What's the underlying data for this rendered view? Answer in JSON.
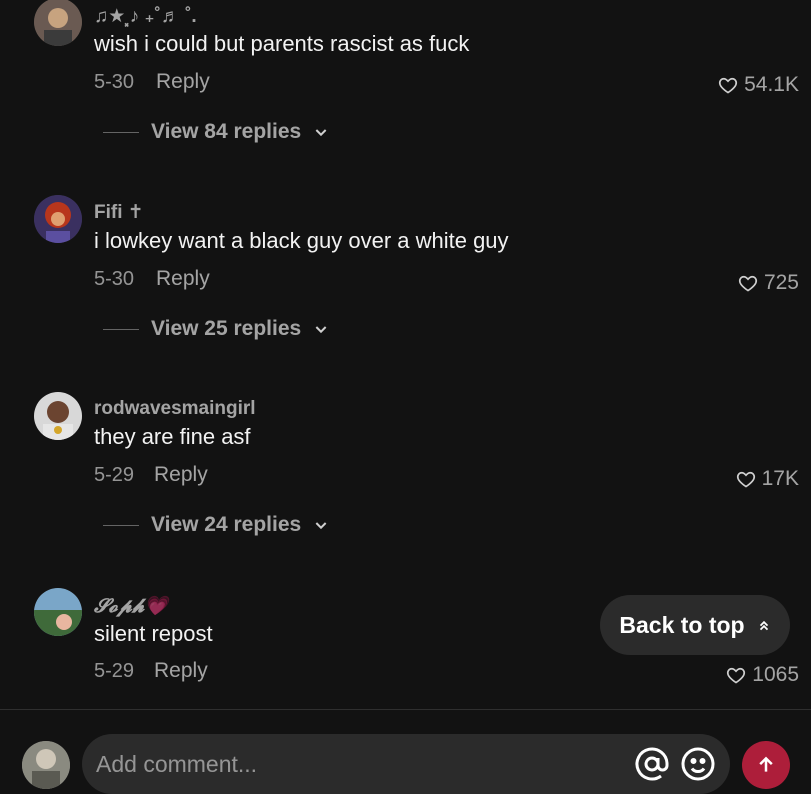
{
  "comments": [
    {
      "username": "♫★⸼♪ ₊˚♬ ˚.",
      "text": "wish i could but parents rascist as fuck",
      "date": "5-30",
      "reply_label": "Reply",
      "likes": "54.1K",
      "view_replies": "View 84 replies"
    },
    {
      "username": "Fifi ✝",
      "text": "i lowkey want a black guy over a white guy",
      "date": "5-30",
      "reply_label": "Reply",
      "likes": "725",
      "view_replies": "View 25 replies"
    },
    {
      "username": "rodwavesmaingirl",
      "text": "they are fine asf",
      "date": "5-29",
      "reply_label": "Reply",
      "likes": "17K",
      "view_replies": "View 24 replies"
    },
    {
      "username": "𝓢𝓸𝓹𝓱💗",
      "text": "silent repost",
      "date": "5-29",
      "reply_label": "Reply",
      "likes": "1065"
    }
  ],
  "back_to_top": "Back to top",
  "composer": {
    "placeholder": "Add comment..."
  },
  "icons": {
    "like": "heart-outline-icon",
    "expand": "chevron-down-icon",
    "back_to_top": "double-chevron-up-icon",
    "mention": "at-icon",
    "emoji": "emoji-icon",
    "send": "arrow-up-icon"
  },
  "colors": {
    "background": "#121212",
    "send_button": "#ad1e3a",
    "pill": "#2b2b2b"
  }
}
